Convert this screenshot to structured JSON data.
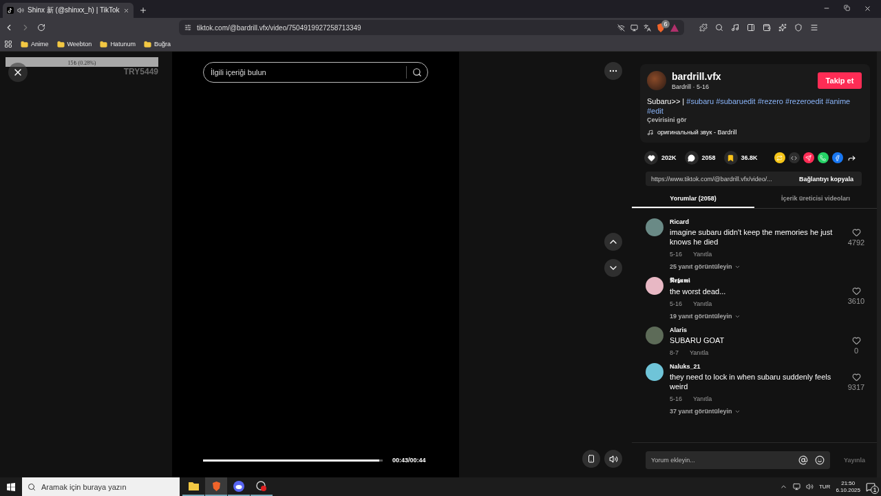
{
  "browser": {
    "tab": {
      "title": "Shinx 新 (@shinxx_h) | TikTok",
      "audio_playing": true
    },
    "url": "tiktok.com/@bardrill.vfx/video/7504919927258713349",
    "shield_count": "6",
    "bookmarks": [
      "Anime",
      "Weebton",
      "Hatunum",
      "Buğra"
    ]
  },
  "overlay": {
    "bar_text": "15₺ (0.28%)",
    "right_label": "TRY5449"
  },
  "video": {
    "search": {
      "placeholder": "İlgili içeriği bulun"
    },
    "progress": {
      "level": 0.98
    },
    "time": "00:43/00:44"
  },
  "post": {
    "username": "bardrill.vfx",
    "meta": "Bardrill · 5-16",
    "follow": "Takip et",
    "caption": {
      "text": "Subaru>> |",
      "hashtags": [
        "#subaru",
        "#subaruedit",
        "#rezero",
        "#rezeroedit",
        "#anime",
        "#edit"
      ]
    },
    "translate": "Çevirisini gör",
    "sound": "оригинальный звук - Bardrill"
  },
  "stats": [
    {
      "kind": "like",
      "count": "202K"
    },
    {
      "kind": "comment",
      "count": "2058"
    },
    {
      "kind": "save",
      "count": "36.8K"
    }
  ],
  "link": {
    "url": "https://www.tiktok.com/@bardrill.vfx/video/...",
    "copy": "Bağlantıyı kopyala"
  },
  "tabs": [
    {
      "label": "Yorumlar (2058)",
      "selected": true
    },
    {
      "label": "İçerik üreticisi videoları",
      "selected": false
    }
  ],
  "comments": [
    {
      "user": "Ricard",
      "color": "#6a8a86",
      "text": "imagine subaru didn't keep the memories he just knows he died",
      "date": "5-16",
      "reply": "Yanıtla",
      "likes": "4792",
      "replies": "25 yanıt görüntüleyin"
    },
    {
      "user": "𝕹𝖊𝖇𝖚𝖒𝖎",
      "color": "#e8b8c4",
      "text": "the worst dead...",
      "date": "5-16",
      "reply": "Yanıtla",
      "likes": "3610",
      "replies": "19 yanıt görüntüleyin"
    },
    {
      "user": "Alaris",
      "color": "#5d6b58",
      "text": "SUBARU GOAT",
      "date": "8-7",
      "reply": "Yanıtla",
      "likes": "0"
    },
    {
      "user": "Naluks_21",
      "color": "#6fc4d8",
      "text": "they need to lock in when subaru suddenly feels weird",
      "date": "5-16",
      "reply": "Yanıtla",
      "likes": "9317",
      "replies": "37 yanıt görüntüleyin"
    }
  ],
  "comment_box": {
    "placeholder": "Yorum ekleyin...",
    "post": "Yayınla",
    "post_disabled": true
  },
  "taskbar": {
    "search": {
      "placeholder": "Aramak için buraya yazın"
    },
    "language": "TUR",
    "time": "21:50",
    "date": "6.10.2025",
    "notifications": "1"
  }
}
